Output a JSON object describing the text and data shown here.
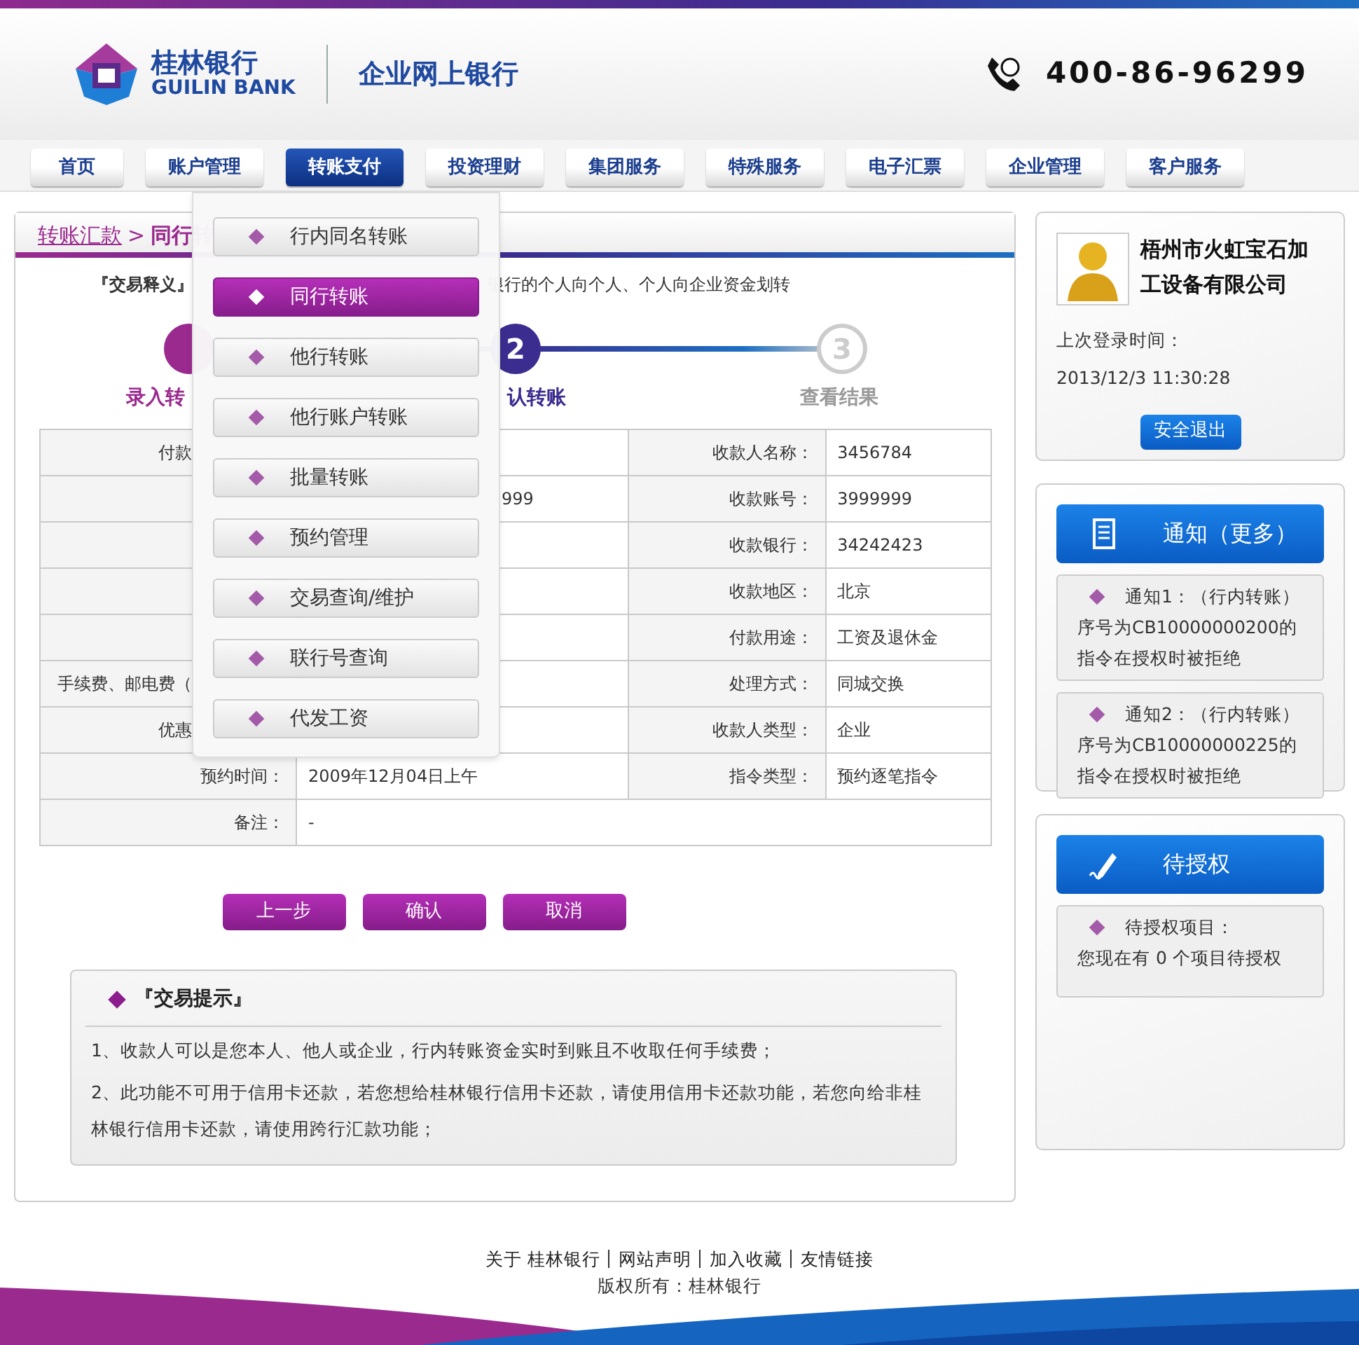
{
  "header": {
    "logo_cn": "桂林银行",
    "logo_en": "GUILIN BANK",
    "title": "企业网上银行",
    "hotline": "400-86-96299"
  },
  "nav": [
    {
      "label": "首页",
      "selected": false
    },
    {
      "label": "账户管理",
      "selected": false
    },
    {
      "label": "转账支付",
      "selected": true
    },
    {
      "label": "投资理财",
      "selected": false
    },
    {
      "label": "集团服务",
      "selected": false
    },
    {
      "label": "特殊服务",
      "selected": false
    },
    {
      "label": "电子汇票",
      "selected": false
    },
    {
      "label": "企业管理",
      "selected": false
    },
    {
      "label": "客户服务",
      "selected": false
    }
  ],
  "dropdown": [
    {
      "label": "行内同名转账",
      "selected": false
    },
    {
      "label": "同行转账",
      "selected": true
    },
    {
      "label": "他行转账",
      "selected": false
    },
    {
      "label": "他行账户转账",
      "selected": false
    },
    {
      "label": "批量转账",
      "selected": false
    },
    {
      "label": "预约管理",
      "selected": false
    },
    {
      "label": "交易查询/维护",
      "selected": false
    },
    {
      "label": "联行号查询",
      "selected": false
    },
    {
      "label": "代发工资",
      "selected": false
    }
  ],
  "breadcrumb": {
    "parent": "转账汇款",
    "separator": ">",
    "current": "同行转"
  },
  "description": {
    "label": "『交易释义』",
    "text": "银行的个人向个人、个人向企业资金划转"
  },
  "steps": [
    {
      "label": "录入转",
      "completed": true,
      "active": false
    },
    {
      "number": "2",
      "label": "认转账",
      "completed": false,
      "active": true
    },
    {
      "number": "3",
      "label": "查看结果",
      "completed": false,
      "active": false
    }
  ],
  "table": {
    "rows": [
      {
        "label": "付款",
        "label_2": "收款人名称：",
        "value_2": "3456784"
      },
      {
        "value": "999",
        "label_2": "收款账号：",
        "value_2": "3999999"
      },
      {
        "label_2": "收款银行：",
        "value_2": "34242423"
      },
      {
        "label_2": "收款地区：",
        "value_2": "北京"
      },
      {
        "label_2": "付款用途：",
        "value_2": "工资及退休金"
      },
      {
        "label": "手续费、邮电费（",
        "label_2": "处理方式：",
        "value_2": "同城交换"
      },
      {
        "label": "优惠",
        "label_2": "收款人类型：",
        "value_2": "企业"
      },
      {
        "label": "预约时间：",
        "value": "2009年12月04日上午",
        "label_2": "指令类型：",
        "value_2": "预约逐笔指令"
      },
      {
        "label": "备注：",
        "value": "-"
      }
    ]
  },
  "buttons": [
    "上一步",
    "确认",
    "取消"
  ],
  "tips": {
    "title": "『交易提示』",
    "items": [
      "1、收款人可以是您本人、他人或企业，行内转账资金实时到账且不收取任何手续费；",
      "2、此功能不可用于信用卡还款，若您想给桂林银行信用卡还款，请使用信用卡还款功能，若您向给非桂林银行信用卡还款，请使用跨行汇款功能；"
    ]
  },
  "user": {
    "name": "梧州市火虹宝石加工设备有限公司",
    "last_login_label": "上次登录时间：",
    "last_login": "2013/12/3 11:30:28",
    "logout": "安全退出"
  },
  "notices": {
    "title": "通知（更多）",
    "items": [
      {
        "title": "通知1：（行内转账）",
        "text": "序号为CB10000000200的指令在授权时被拒绝"
      },
      {
        "title": "通知2：（行内转账）",
        "text": "序号为CB10000000225的指令在授权时被拒绝"
      }
    ]
  },
  "pending": {
    "title": "待授权",
    "items": [
      {
        "title": "待授权项目：",
        "text": "您现在有 0 个项目待授权"
      }
    ]
  },
  "footer": {
    "links": [
      "关于 桂林银行",
      "网站声明",
      "加入收藏",
      "友情链接"
    ],
    "copyright": "版权所有：桂林银行"
  }
}
